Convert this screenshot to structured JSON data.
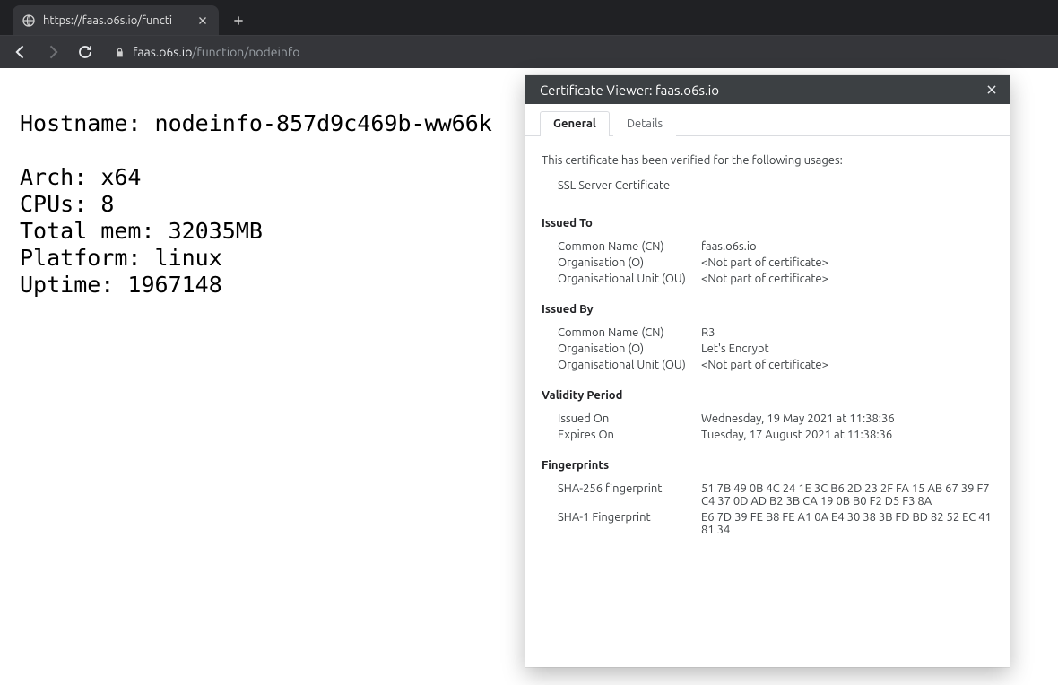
{
  "browser": {
    "tab_title": "https://faas.o6s.io/functi",
    "url_host": "faas.o6s.io",
    "url_path": "/function/nodeinfo"
  },
  "page": {
    "hostname_label": "Hostname: ",
    "hostname_value": "nodeinfo-857d9c469b-ww66k",
    "arch_label": "Arch: ",
    "arch_value": "x64",
    "cpus_label": "CPUs: ",
    "cpus_value": "8",
    "mem_label": "Total mem: ",
    "mem_value": "32035MB",
    "platform_label": "Platform: ",
    "platform_value": "linux",
    "uptime_label": "Uptime: ",
    "uptime_value": "1967148"
  },
  "cert": {
    "title": "Certificate Viewer: faas.o6s.io",
    "tabs": {
      "general": "General",
      "details": "Details"
    },
    "intro": "This certificate has been verified for the following usages:",
    "usage": "SSL Server Certificate",
    "sections": {
      "issued_to": {
        "heading": "Issued To",
        "cn_label": "Common Name (CN)",
        "cn_value": "faas.o6s.io",
        "o_label": "Organisation (O)",
        "o_value": "<Not part of certificate>",
        "ou_label": "Organisational Unit (OU)",
        "ou_value": "<Not part of certificate>"
      },
      "issued_by": {
        "heading": "Issued By",
        "cn_label": "Common Name (CN)",
        "cn_value": "R3",
        "o_label": "Organisation (O)",
        "o_value": "Let's Encrypt",
        "ou_label": "Organisational Unit (OU)",
        "ou_value": "<Not part of certificate>"
      },
      "validity": {
        "heading": "Validity Period",
        "issued_label": "Issued On",
        "issued_value": "Wednesday, 19 May 2021 at 11:38:36",
        "expires_label": "Expires On",
        "expires_value": "Tuesday, 17 August 2021 at 11:38:36"
      },
      "fingerprints": {
        "heading": "Fingerprints",
        "sha256_label": "SHA-256 fingerprint",
        "sha256_value": "51 7B 49 0B 4C 24 1E 3C B6 2D 23 2F FA 15 AB 67 39 F7 C4 37 0D AD B2 3B CA 19 0B B0 F2 D5 F3 8A",
        "sha1_label": "SHA-1 Fingerprint",
        "sha1_value": "E6 7D 39 FE B8 FE A1 0A E4 30 38 3B FD BD 82 52 EC 41 81 34"
      }
    }
  }
}
